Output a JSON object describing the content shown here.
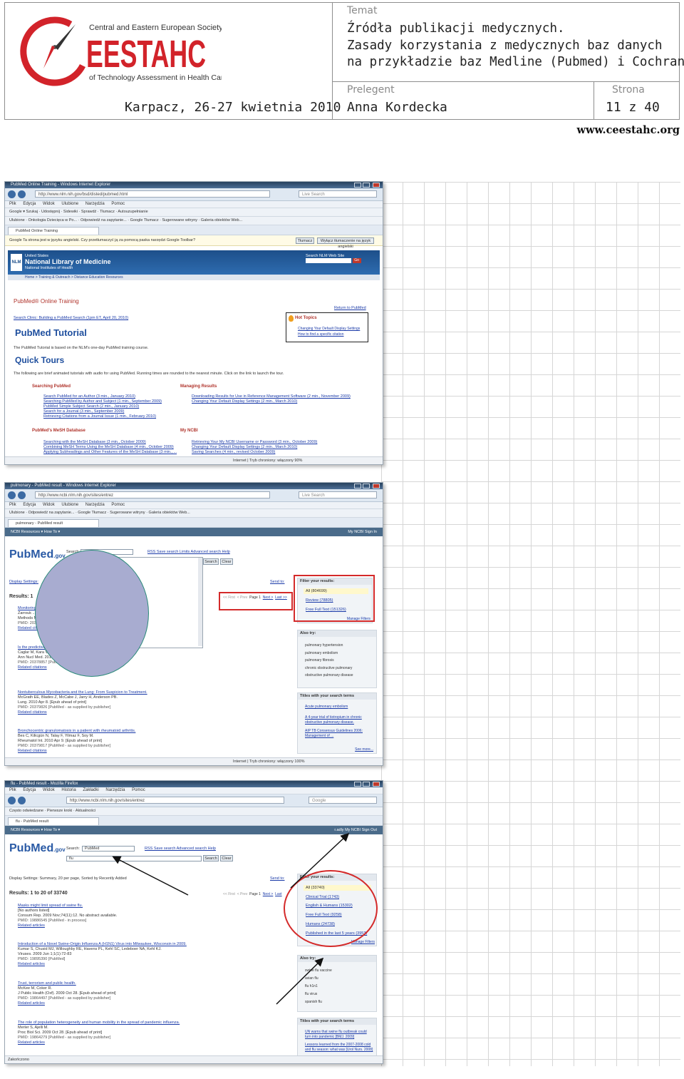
{
  "header": {
    "org_line1": "Central and Eastern European Society",
    "org_acronym": "EESTAHC",
    "org_line2": "of Technology Assessment in Health Care",
    "location_date": "Karpacz, 26-27 kwietnia 2010",
    "topic_label": "Temat",
    "topic_lines": [
      "Źródła publikacji medycznych.",
      "Zasady korzystania z medycznych baz danych",
      "na przykładzie baz Medline (Pubmed) i Cochrane"
    ],
    "speaker_label": "Prelegent",
    "speaker": "Anna Kordecka",
    "page_label": "Strona",
    "page": "11 z 40",
    "website": "www.ceestahc.org"
  },
  "colors": {
    "logo_red": "#d2232a",
    "border": "#8e8e8e",
    "annotation_red": "#d42a2a"
  },
  "screenshot1": {
    "window_title": "PubMed Online Training - Windows Internet Explorer",
    "url": "http://www.nlm.nih.gov/bsd/disted/pubmed.html",
    "search_placeholder": "Live Search",
    "menu": [
      "Plik",
      "Edycja",
      "Widok",
      "Ulubione",
      "Narzędzia",
      "Pomoc"
    ],
    "google_toolbar": "Google  ▾  Szukaj  ·  Udostępnij  ·  Sidewiki  ·  Sprawdź  ·  Tłumacz  ·  Autouzupełnianie",
    "favorites": "Ulubione  ·  Onkologia Dziecięca w Po...  ·  Odpowiedź na zapytanie...  ·  Google Tłumacz  ·  Sugerowane witryny  ·  Galeria obiektów Web...",
    "tab": "PubMed Online Training",
    "translate_bar": "Google  Ta strona jest w języku angielski. Czy przetłumaczyć ją za pomocą paska narzędzi Google Toolbar?",
    "translate_buttons": [
      "Tłumacz",
      "Wyłącz tłumaczenie na język angielski"
    ],
    "nlm_line1": "United States",
    "nlm_name": "National Library of Medicine",
    "nlm_line3": "National Institutes of Health",
    "search_site": "Search NLM Web Site",
    "breadcrumb": "Home > Training & Outreach > Distance Education Resources",
    "page_title": "PubMed® Online Training",
    "return_link": "Return to PubMed",
    "search_clinic": "Search Clinic: Building a PubMed Search (1pm ET, April 20, 2010)",
    "hot_topics_title": "Hot Topics",
    "hot_topics": [
      "Changing Your Default Display Settings",
      "How to find a specific citation"
    ],
    "tutorial_title": "PubMed Tutorial",
    "tutorial_note": "The PubMed Tutorial is based on the NLM's one-day PubMed training course.",
    "quick_tours_title": "Quick Tours",
    "quick_tours_note": "The following are brief animated tutorials with audio for using PubMed. Running times are rounded to the nearest minute. Click on the link to launch the tour.",
    "sections": [
      {
        "title": "Searching PubMed",
        "items": [
          "Search PubMed for an Author (3 min., January 2010)",
          "Searching PubMed by Author and Subject (1 min., September 2009)",
          "PubMed Simple Subject Search (2 min., January 2010)",
          "Search for a Journal (3 min., September 2009)",
          "Retrieving Citations from a Journal Issue (1 min., February 2010)"
        ]
      },
      {
        "title": "Managing Results",
        "items": [
          "Downloading Results for Use in Reference Management Software (2 min., November 2009)",
          "Changing Your Default Display Settings (2 min., March 2010)"
        ]
      },
      {
        "title": "PubMed's MeSH Database",
        "items": [
          "Searching with the MeSH Database (3 min., October 2009)",
          "Combining MeSH Terms Using the MeSH Database (4 min., October 2009)",
          "Applying Subheadings and Other Features of the MeSH Database (3 min., ..."
        ]
      },
      {
        "title": "My NCBI",
        "items": [
          "Retrieving Your My NCBI Username or Password (3 min., October 2009)",
          "Changing Your Default Display Settings (2 min., March 2010)",
          "Saving Searches (4 min., revised October 2009)"
        ]
      }
    ],
    "status": "Internet | Tryb chroniony: włączony   90%"
  },
  "screenshot2": {
    "window_title": "pulmonary - PubMed result - Windows Internet Explorer",
    "url": "http://www.ncbi.nlm.nih.gov/sites/entrez",
    "search_placeholder": "Live Search",
    "menu": [
      "Plik",
      "Edycja",
      "Widok",
      "Ulubione",
      "Narzędzia",
      "Pomoc"
    ],
    "favorites": "Ulubione  ·  Odpowiedź na zapytanie...  ·  Google Tłumacz  ·  Sugerowane witryny  ·  Galeria obiektów Web...",
    "tab": "pulmonary - PubMed result",
    "ncbi_bar": "NCBI   Resources ▾   How To ▾",
    "signin": "My NCBI  Sign In",
    "search_label": "Search:",
    "links": "RSS  Save search  Limits  Advanced search  Help",
    "buttons": [
      "Search",
      "Clear"
    ],
    "display_settings": "Display Settings:",
    "send_to": "Send to:",
    "results_count": "Results: 1",
    "pager": [
      "<< First",
      "< Prev",
      "Page 1",
      "Next >",
      "Last >>"
    ],
    "filter_title": "Filter your results:",
    "filters": [
      "All (804699)",
      "Review (78805)",
      "Free Full Text (151326)"
    ],
    "manage_filters": "Manage Filters",
    "also_try_title": "Also try:",
    "also_try": [
      "pulmonary hypertension",
      "pulmonary embolism",
      "pulmonary fibrosis",
      "chronic obstructive pulmonary",
      "obstructive pulmonary disease"
    ],
    "titles_title": "Titles with your search terms",
    "titles": [
      "Acute pulmonary embolism",
      "A 4-year trial of tiotropium in chronic obstructive pulmonary disease.",
      "AIP TB Consensus Guidelines 2006: Management of ..."
    ],
    "see_more": "See more...",
    "results": [
      {
        "title": "Monitoring ...",
        "authors": "Zarrouk ...",
        "journal": "Methods M...",
        "pmid": "PMID: 2037...",
        "related": "Related citations"
      },
      {
        "title": "Is the predictive ... patients undergoing pulmonary resection?",
        "authors": "Caglar M, Kara V, A... R.",
        "journal": "Ann Nucl Med. 2010 Apr 9. [Epub ahead of print]",
        "pmid": "PMID: 20378857 [PubMed - as supplied by publisher]",
        "related": "Related citations"
      },
      {
        "title": "Nontuberculous Mycobacteria and the Lung: From Suspicion to Treatment.",
        "authors": "McGrath EE, Blades Z, McCabe J, Jarry H, Anderson PB.",
        "journal": "Lung. 2010 Apr 8. [Epub ahead of print]",
        "pmid": "PMID: 20379826 [PubMed - as supplied by publisher]",
        "related": "Related citations"
      },
      {
        "title": "Bronchocentric granulomatosis in a patient with rheumatoid arthritis.",
        "authors": "Bes C, Kilicgün N, Talay F, Yilmaz F, Soy M.",
        "journal": "Rheumatol Int. 2010 Apr 9. [Epub ahead of print]",
        "pmid": "PMID: 20379817 [PubMed - as supplied by publisher]",
        "related": "Related citations"
      }
    ],
    "status": "Internet | Tryb chroniony: włączony   100%"
  },
  "screenshot3": {
    "window_title": "flu - PubMed result - Mozilla Firefox",
    "url": "http://www.ncbi.nlm.nih.gov/sites/entrez",
    "search_placeholder": "Google",
    "menu": [
      "Plik",
      "Edycja",
      "Widok",
      "Historia",
      "Zakładki",
      "Narzędzia",
      "Pomoc"
    ],
    "bookmarks": "Często odwiedzane  ·  Pierwsze kroki  ·  Aktualności",
    "tab": "flu - PubMed result",
    "ncbi_bar": "NCBI   Resources ▾   How To ▾",
    "signin": "r.adly  My NCBI  Sign Out",
    "search_label": "Search:",
    "search_db": "PubMed",
    "query": "flu",
    "links": "RSS  Save search  Advanced search  Help",
    "buttons": [
      "Search",
      "Clear"
    ],
    "display_settings": "Display Settings:  Summary, 20 per page, Sorted by Recently Added",
    "send_to": "Send to:",
    "results_count": "Results: 1 to 20 of 33740",
    "pager": [
      "<< First",
      "< Prev",
      "Page 1",
      "Next >",
      "Last"
    ],
    "filter_title": "Filter your results:",
    "filters": [
      "All (33740)",
      "Clinical Trial (1743)",
      "English & Humans (15302)",
      "Free Full Text (9258)",
      "Humans (24738)",
      "Published in the last 5 years (3953)"
    ],
    "manage_filters": "Manage Filters",
    "also_try_title": "Also try:",
    "also_try": [
      "swine flu vaccine",
      "avian flu",
      "flu h1n1",
      "flu virus",
      "spanish flu"
    ],
    "titles_title": "Titles with your search terms",
    "titles": [
      "UN warns that swine flu outbreak could turn into pandemic  [BMJ. 2009]",
      "Lessons learned from the 2007-2008 cold and flu season: what was  [Urol Nurs. 2008]"
    ],
    "results": [
      {
        "title": "Masks might limit spread of swine flu.",
        "authors": "[No authors listed]",
        "journal": "Consum Rep. 2009 Nov;74(11):12. No abstract available.",
        "pmid": "PMID: 19886545 [PubMed - in process]",
        "related": "Related articles"
      },
      {
        "title": "Introduction of a Novel Swine-Origin Influenza A (H1N1) Virus into Milwaukee, Wisconsin in 2009.",
        "authors": "Kumar S, Chusid MJ, Willoughby RE, Havens PL, Kehl SC, Ledeboer NA, Kehl KJ.",
        "journal": "Viruses. 2009 Jun 1;1(1):72-83",
        "pmid": "PMID: 19895390 [PubMed]",
        "related": "Related articles"
      },
      {
        "title": "Trust, terrorism and public health.",
        "authors": "McKee M, Coker R.",
        "journal": "J Public Health (Oxf). 2009 Oct 28. [Epub ahead of print]",
        "pmid": "PMID: 19864497 [PubMed - as supplied by publisher]",
        "related": "Related articles"
      },
      {
        "title": "The role of population heterogeneity and human mobility in the spread of pandemic influenza.",
        "authors": "Merler S, Ajelli M.",
        "journal": "Proc Biol Sci. 2009 Oct 28. [Epub ahead of print]",
        "pmid": "PMID: 19864279 [PubMed - as supplied by publisher]",
        "related": "Related articles"
      }
    ],
    "status": "Zakończono"
  }
}
